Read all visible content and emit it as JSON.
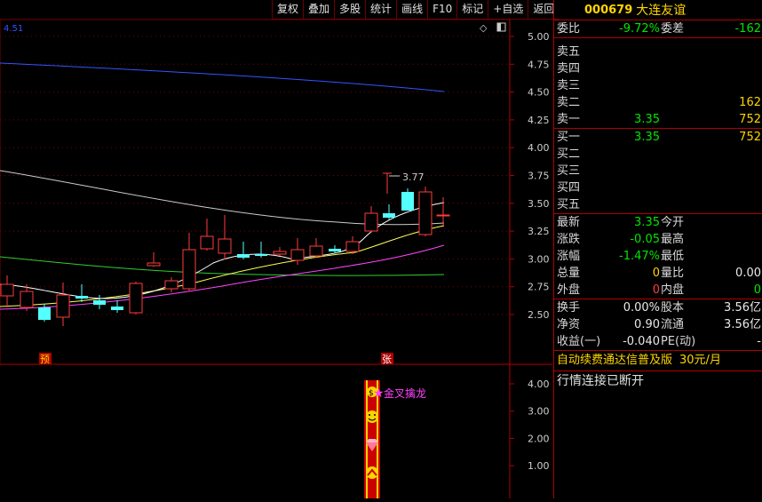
{
  "toolbar": {
    "items": [
      "复权",
      "叠加",
      "多股",
      "统计",
      "画线",
      "F10",
      "标记",
      "+自选",
      "返回"
    ]
  },
  "chart": {
    "ma_value": "4.51",
    "price_axis": [
      "5.00",
      "4.75",
      "4.50",
      "4.25",
      "4.00",
      "3.75",
      "3.50",
      "3.25",
      "3.00",
      "2.75",
      "2.50"
    ],
    "high_label": "3.77",
    "marker_yu": "预",
    "marker_zhang": "张",
    "indicator_axis": [
      "4.00",
      "3.00",
      "2.00",
      "1.00"
    ],
    "signal_label": "金叉擒龙",
    "colors": {
      "up": "#ff3b3b",
      "down": "#54ffff",
      "grid": "#7a0000",
      "ma5": "#ffffff",
      "ma10": "#ffff55",
      "ma20": "#ff44ff",
      "ma60": "#33cc33",
      "ma120": "#cccccc",
      "ma250": "#3355ff"
    }
  },
  "stock": {
    "code": "000679",
    "name": "大连友谊"
  },
  "orderbook": {
    "weibi_label": "委比",
    "weibi_value": "-9.72%",
    "weicha_label": "委差",
    "weicha_value": "-162",
    "sell": [
      {
        "label": "卖五",
        "price": "",
        "vol": ""
      },
      {
        "label": "卖四",
        "price": "",
        "vol": ""
      },
      {
        "label": "卖三",
        "price": "",
        "vol": ""
      },
      {
        "label": "卖二",
        "price": "",
        "vol": "162"
      },
      {
        "label": "卖一",
        "price": "3.35",
        "vol": "752"
      }
    ],
    "buy": [
      {
        "label": "买一",
        "price": "3.35",
        "vol": "752"
      },
      {
        "label": "买二",
        "price": "",
        "vol": ""
      },
      {
        "label": "买三",
        "price": "",
        "vol": ""
      },
      {
        "label": "买四",
        "price": "",
        "vol": ""
      },
      {
        "label": "买五",
        "price": "",
        "vol": ""
      }
    ]
  },
  "quote": {
    "rows1": [
      {
        "l1": "最新",
        "v1": "3.35",
        "c1": "green",
        "l2": "今开",
        "v2": "",
        "c2": "white"
      },
      {
        "l1": "涨跌",
        "v1": "-0.05",
        "c1": "green",
        "l2": "最高",
        "v2": "",
        "c2": "white"
      },
      {
        "l1": "涨幅",
        "v1": "-1.47%",
        "c1": "green",
        "l2": "最低",
        "v2": "",
        "c2": "white"
      },
      {
        "l1": "总量",
        "v1": "0",
        "c1": "yellow",
        "l2": "量比",
        "v2": "0.00",
        "c2": "white"
      },
      {
        "l1": "外盘",
        "v1": "0",
        "c1": "red",
        "l2": "内盘",
        "v2": "0",
        "c2": "green"
      }
    ],
    "rows2": [
      {
        "l1": "换手",
        "v1": "0.00%",
        "c1": "white",
        "l2": "股本",
        "v2": "3.56亿",
        "c2": "white"
      },
      {
        "l1": "净资",
        "v1": "0.90",
        "c1": "white",
        "l2": "流通",
        "v2": "3.56亿",
        "c2": "white"
      },
      {
        "l1": "收益(一)",
        "v1": "-0.040",
        "c1": "white",
        "l2": "PE(动)",
        "v2": "-",
        "c2": "white"
      }
    ]
  },
  "ad": {
    "text": "自动续费通达信普及版",
    "price": "30元/月"
  },
  "status": "行情连接已断开"
}
